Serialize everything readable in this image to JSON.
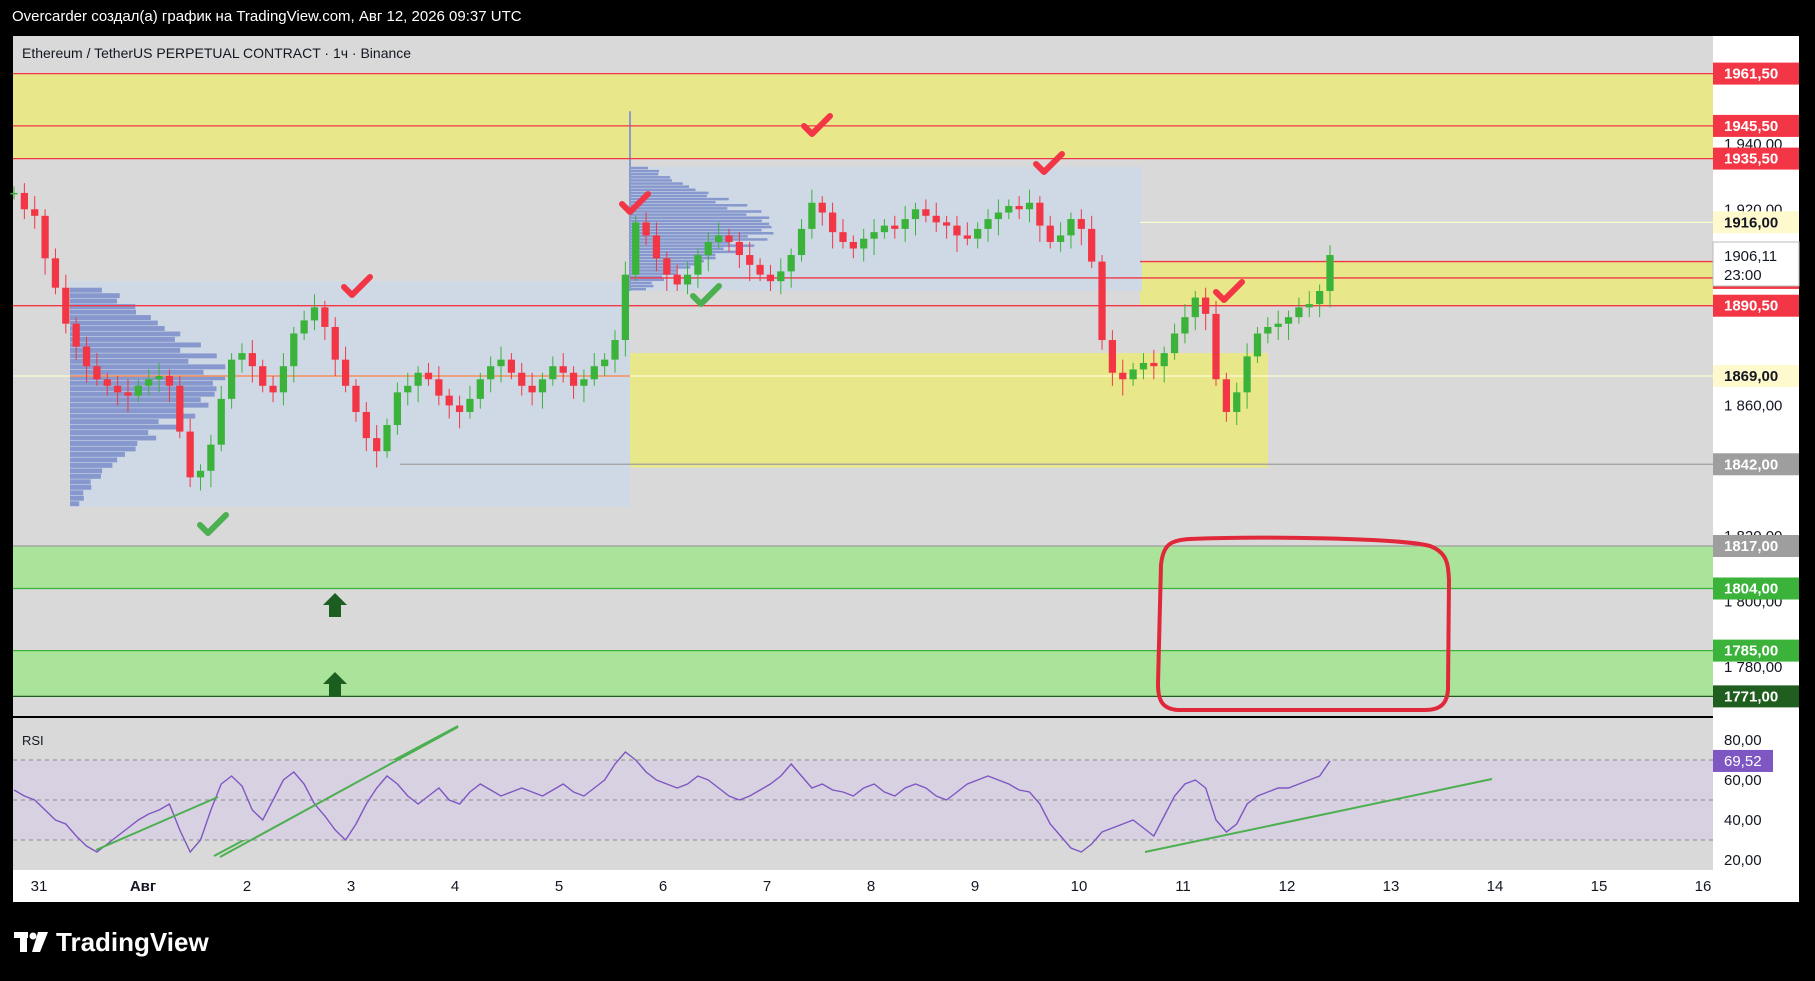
{
  "header": {
    "attribution": "Overcarder создал(а) график на TradingView.com, Авг 12, 2026 09:37 UTC"
  },
  "footer": {
    "brand": "TradingView"
  },
  "chart_data": {
    "type": "candlestick",
    "title": "Ethereum / TetherUS PERPETUAL CONTRACT · 1ч · Binance",
    "x_labels": [
      "31",
      "Авг",
      "2",
      "3",
      "4",
      "5",
      "6",
      "7",
      "8",
      "9",
      "10",
      "11",
      "12",
      "13",
      "14",
      "15",
      "16"
    ],
    "y_ticks": [
      "1 940,00",
      "1 920,00",
      "1 860,00",
      "1 820,00",
      "1 800,00",
      "1 780,00"
    ],
    "ylim": [
      1765,
      1973
    ],
    "last_price": {
      "value": "1906,11",
      "countdown": "23:00"
    },
    "price_levels": [
      {
        "label": "1961,50",
        "value": 1961.5,
        "color": "#f23645"
      },
      {
        "label": "1945,50",
        "value": 1945.5,
        "color": "#f23645"
      },
      {
        "label": "1935,50",
        "value": 1935.5,
        "color": "#f23645"
      },
      {
        "label": "1916,00",
        "value": 1916.0,
        "color": "#fffacd"
      },
      {
        "label": "1904,00",
        "value": 1904.0,
        "color": "#f23645"
      },
      {
        "label": "1899,00",
        "value": 1899.0,
        "color": "#f23645"
      },
      {
        "label": "1890,50",
        "value": 1890.5,
        "color": "#f23645"
      },
      {
        "label": "1869,00",
        "value": 1869.0,
        "color": "#fffacd"
      },
      {
        "label": "1842,00",
        "value": 1842.0,
        "color": "#9e9e9e"
      },
      {
        "label": "1817,00",
        "value": 1817.0,
        "color": "#9e9e9e"
      },
      {
        "label": "1804,00",
        "value": 1804.0,
        "color": "#3bb33b"
      },
      {
        "label": "1785,00",
        "value": 1785.0,
        "color": "#3bb33b"
      },
      {
        "label": "1771,00",
        "value": 1771.0,
        "color": "#1f5e1f"
      }
    ],
    "zones": [
      {
        "kind": "supply",
        "from": 1935.5,
        "to": 1961.5,
        "color": "#e8e88a"
      },
      {
        "kind": "demand",
        "from": 1804.0,
        "to": 1817.0,
        "color": "#a9e49a"
      },
      {
        "kind": "demand",
        "from": 1771.0,
        "to": 1785.0,
        "color": "#a9e49a"
      }
    ],
    "price_series_approx": [
      1925,
      1920,
      1918,
      1905,
      1896,
      1885,
      1878,
      1872,
      1868,
      1866,
      1864,
      1863,
      1866,
      1868,
      1869,
      1866,
      1852,
      1838,
      1840,
      1848,
      1862,
      1874,
      1876,
      1872,
      1866,
      1864,
      1872,
      1882,
      1886,
      1890,
      1884,
      1874,
      1866,
      1858,
      1850,
      1846,
      1854,
      1864,
      1866,
      1870,
      1868,
      1863,
      1860,
      1858,
      1862,
      1868,
      1872,
      1874,
      1870,
      1866,
      1864,
      1868,
      1872,
      1870,
      1866,
      1868,
      1872,
      1874,
      1880,
      1900,
      1916,
      1912,
      1905,
      1900,
      1897,
      1900,
      1906,
      1910,
      1912,
      1910,
      1906,
      1903,
      1900,
      1898,
      1901,
      1906,
      1914,
      1922,
      1919,
      1913,
      1910,
      1908,
      1911,
      1913,
      1915,
      1914,
      1917,
      1920,
      1918,
      1916,
      1915,
      1912,
      1911,
      1914,
      1917,
      1919,
      1921,
      1920,
      1922,
      1915,
      1910,
      1912,
      1917,
      1914,
      1904,
      1880,
      1870,
      1868,
      1871,
      1873,
      1872,
      1876,
      1882,
      1887,
      1893,
      1888,
      1868,
      1858,
      1864,
      1875,
      1882,
      1884,
      1885,
      1887,
      1890,
      1891,
      1895,
      1906
    ],
    "rsi": {
      "label": "RSI",
      "value": "69,52",
      "ticks": [
        "80,00",
        "60,00",
        "40,00",
        "20,00"
      ],
      "bands": [
        70,
        50,
        30
      ],
      "values_approx": [
        55,
        52,
        50,
        45,
        40,
        38,
        32,
        27,
        24,
        28,
        32,
        36,
        40,
        43,
        45,
        48,
        35,
        24,
        30,
        45,
        58,
        62,
        57,
        45,
        40,
        50,
        60,
        64,
        58,
        48,
        42,
        35,
        30,
        38,
        48,
        56,
        62,
        58,
        52,
        48,
        52,
        56,
        50,
        48,
        54,
        58,
        55,
        52,
        54,
        56,
        54,
        52,
        55,
        58,
        54,
        52,
        56,
        60,
        68,
        74,
        70,
        64,
        60,
        58,
        56,
        58,
        62,
        60,
        56,
        52,
        50,
        52,
        55,
        58,
        62,
        68,
        62,
        56,
        58,
        55,
        54,
        52,
        56,
        58,
        54,
        52,
        56,
        58,
        56,
        52,
        50,
        54,
        58,
        60,
        62,
        60,
        58,
        55,
        54,
        48,
        38,
        32,
        26,
        24,
        28,
        34,
        36,
        38,
        40,
        36,
        32,
        42,
        52,
        58,
        60,
        56,
        40,
        34,
        38,
        48,
        52,
        54,
        56,
        56,
        58,
        60,
        62,
        69.5
      ]
    },
    "volume_profiles": 2,
    "annotations": [
      "red check marks at local highs",
      "green check marks at local lows",
      "green up arrows in demand zones",
      "red hand-drawn rectangle around 1771-1817 zone on days 10-13",
      "green trendlines on price and RSI"
    ],
    "grid": false,
    "legend": "top-left"
  },
  "colors": {
    "background": "#000000",
    "plot": "#d9d9d9",
    "up": "#3bb33b",
    "down": "#f23645",
    "supply_zone": "#e8e88a",
    "demand_zone": "#a9e49a",
    "profile_bg": "#cfd9e6",
    "profile_bars": "#6e82c4",
    "rsi_line": "#7e57c2",
    "rsi_bg": "#d8d1e1"
  }
}
